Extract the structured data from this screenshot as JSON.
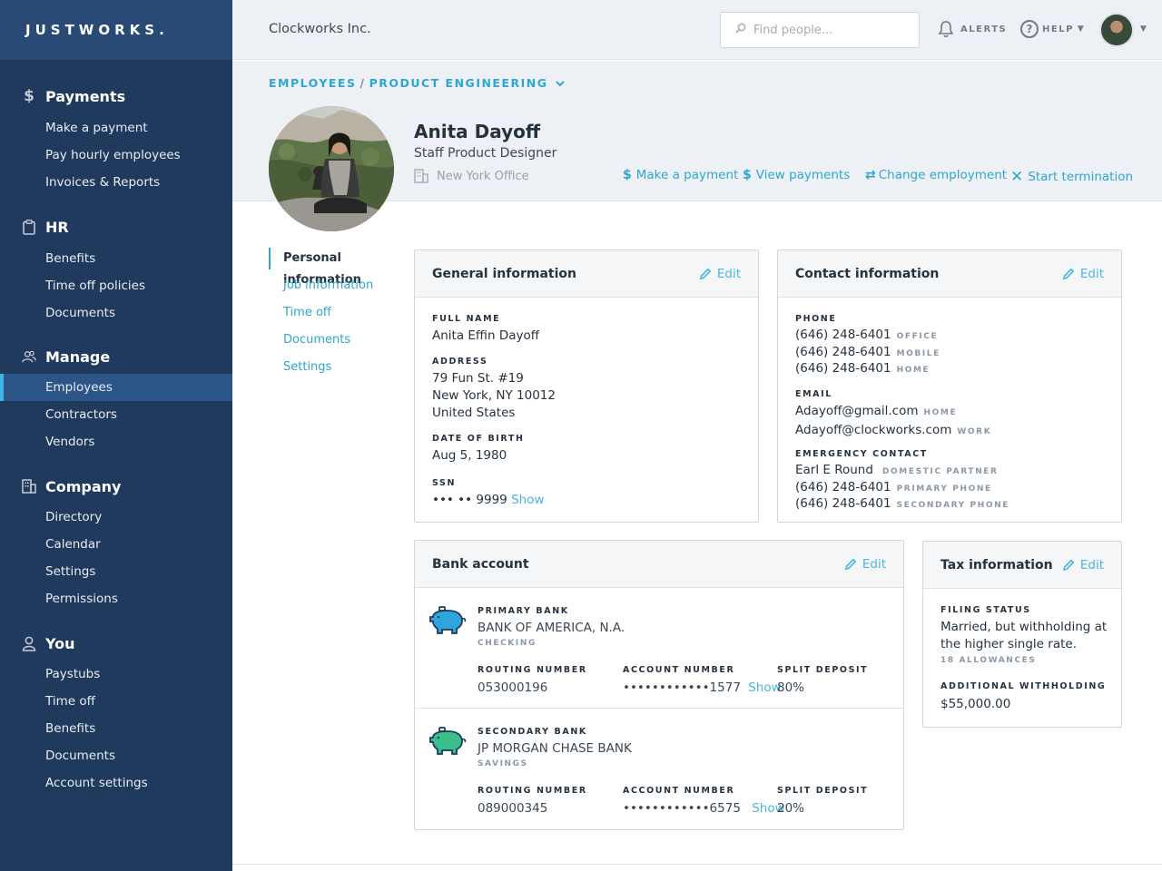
{
  "brand": "JUSTWORKS.",
  "sidebar": {
    "payments": {
      "title": "Payments",
      "icon": "dollar-icon",
      "items": [
        "Make a payment",
        "Pay hourly employees",
        "Invoices & Reports"
      ]
    },
    "hr": {
      "title": "HR",
      "icon": "clipboard-icon",
      "items": [
        "Benefits",
        "Time off policies",
        "Documents"
      ]
    },
    "manage": {
      "title": "Manage",
      "icon": "people-icon",
      "items": [
        "Employees",
        "Contractors",
        "Vendors"
      ]
    },
    "company": {
      "title": "Company",
      "icon": "building-icon",
      "items": [
        "Directory",
        "Calendar",
        "Settings",
        "Permissions"
      ]
    },
    "you": {
      "title": "You",
      "icon": "person-icon",
      "items": [
        "Paystubs",
        "Time off",
        "Benefits",
        "Documents",
        "Account settings"
      ]
    }
  },
  "topbar": {
    "company": "Clockworks Inc.",
    "search_placeholder": "Find people...",
    "alerts": "ALERTS",
    "help": "HELP"
  },
  "breadcrumb": {
    "root": "EMPLOYEES",
    "separator": "/",
    "current": "PRODUCT ENGINEERING"
  },
  "profile": {
    "name": "Anita Dayoff",
    "title": "Staff Product Designer",
    "office": "New York Office"
  },
  "actions": {
    "make_payment": "Make a payment",
    "view_payments": "View payments",
    "change_employment": "Change employment",
    "start_termination": "Start termination"
  },
  "subnav": [
    "Personal information",
    "Job information",
    "Time off",
    "Documents",
    "Settings"
  ],
  "edit_label": "Edit",
  "general": {
    "title": "General information",
    "full_name_label": "FULL NAME",
    "full_name": "Anita Effin Dayoff",
    "address_label": "ADDRESS",
    "address_1": "79 Fun St. #19",
    "address_2": "New York, NY  10012",
    "address_3": "United States",
    "dob_label": "DATE OF BIRTH",
    "dob": "Aug 5, 1980",
    "ssn_label": "SSN",
    "ssn": "••• •• 9999",
    "show": "Show"
  },
  "contact": {
    "title": "Contact information",
    "phone_label": "PHONE",
    "phones": [
      {
        "number": "(646) 248-6401",
        "type": "OFFICE"
      },
      {
        "number": "(646) 248-6401",
        "type": "MOBILE"
      },
      {
        "number": "(646) 248-6401",
        "type": "HOME"
      }
    ],
    "email_label": "EMAIL",
    "emails": [
      {
        "address": "Adayoff@gmail.com",
        "type": "HOME"
      },
      {
        "address": "Adayoff@clockworks.com",
        "type": "WORK"
      }
    ],
    "emergency_label": "EMERGENCY CONTACT",
    "emergency_name": "Earl E Round",
    "emergency_relation": "DOMESTIC PARTNER",
    "emergency_phones": [
      {
        "number": "(646) 248-6401",
        "type": "PRIMARY PHONE"
      },
      {
        "number": "(646) 248-6401",
        "type": "SECONDARY PHONE"
      }
    ]
  },
  "bank": {
    "title": "Bank account",
    "routing_label": "ROUTING NUMBER",
    "account_label": "ACCOUNT NUMBER",
    "split_label": "SPLIT DEPOSIT",
    "primary": {
      "label": "PRIMARY BANK",
      "name": "BANK OF AMERICA, N.A.",
      "type": "CHECKING",
      "routing": "053000196",
      "account": "••••••••••••1577",
      "split": "80%",
      "color": "#2ea6dc"
    },
    "secondary": {
      "label": "SECONDARY BANK",
      "name": "JP MORGAN CHASE BANK",
      "type": "SAVINGS",
      "routing": "089000345",
      "account": "••••••••••••6575",
      "split": "20%",
      "color": "#3bbf8a"
    }
  },
  "tax": {
    "title": "Tax information",
    "filing_label": "FILING STATUS",
    "filing_1": "Married, but withholding at",
    "filing_2": "the higher single rate.",
    "allowances": "18 ALLOWANCES",
    "withholding_label": "ADDITIONAL WITHHOLDING",
    "withholding": "$55,000.00"
  },
  "colors": {
    "sidebar": "#1f3a5c",
    "brand_bar": "#284a75",
    "accent": "#2ea6cf",
    "active_nav": "#2c5687"
  }
}
